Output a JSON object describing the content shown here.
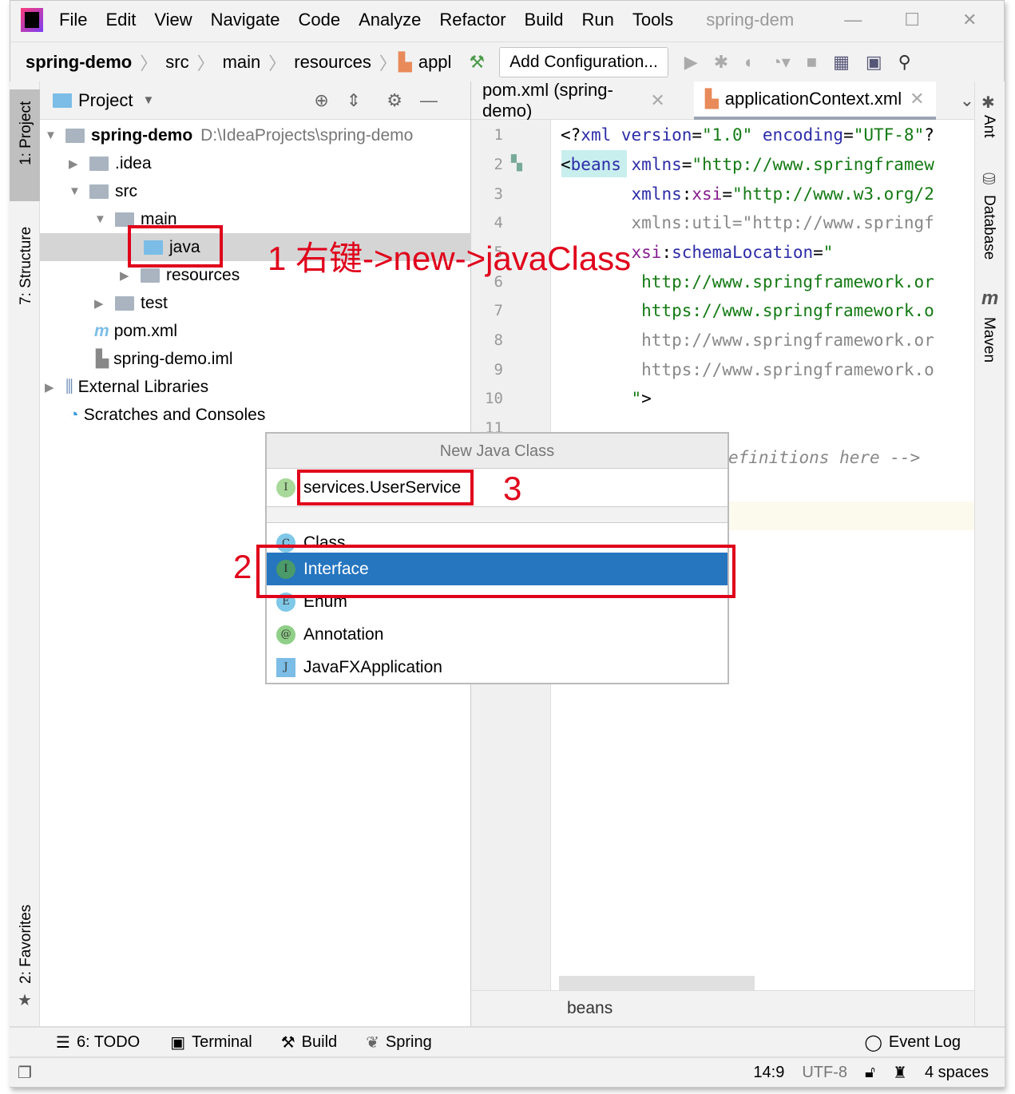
{
  "menu": {
    "items": [
      "File",
      "Edit",
      "View",
      "Navigate",
      "Code",
      "Analyze",
      "Refactor",
      "Build",
      "Run",
      "Tools"
    ],
    "window_title": "spring-dem"
  },
  "navbar": {
    "breadcrumbs": [
      "spring-demo",
      "src",
      "main",
      "resources",
      "appl"
    ],
    "add_config": "Add Configuration..."
  },
  "left_stripe": {
    "project": "1: Project",
    "structure": "7: Structure",
    "favorites": "2: Favorites"
  },
  "project_panel": {
    "title": "Project",
    "tree": [
      {
        "label": "spring-demo",
        "path": "D:\\IdeaProjects\\spring-demo"
      },
      {
        "label": ".idea"
      },
      {
        "label": "src"
      },
      {
        "label": "main"
      },
      {
        "label": "java"
      },
      {
        "label": "resources"
      },
      {
        "label": "test"
      },
      {
        "label": "pom.xml"
      },
      {
        "label": "spring-demo.iml"
      },
      {
        "label": "External Libraries"
      },
      {
        "label": "Scratches and Consoles"
      }
    ]
  },
  "editor": {
    "tabs": [
      {
        "label": "pom.xml (spring-demo)"
      },
      {
        "label": "applicationContext.xml",
        "active": true
      }
    ],
    "line_numbers": [
      "1",
      "2",
      "3",
      "4",
      "5",
      "6",
      "7",
      "8",
      "9",
      "10",
      "11"
    ],
    "comment_tail": "efinitions here -->",
    "breadcrumb": "beans"
  },
  "right_stripe": {
    "ant": "Ant",
    "database": "Database",
    "maven": "Maven"
  },
  "popup": {
    "title": "New Java Class",
    "input_value": "services.UserService",
    "items": [
      {
        "label": "Class",
        "icon": "C",
        "color": "#7fc8e8"
      },
      {
        "label": "Interface",
        "icon": "I",
        "color": "#4a9a6a",
        "selected": true
      },
      {
        "label": "Enum",
        "icon": "E",
        "color": "#7fc8e8"
      },
      {
        "label": "Annotation",
        "icon": "@",
        "color": "#8fcf88"
      },
      {
        "label": "JavaFXApplication",
        "icon": "J",
        "color": "#7bbde6"
      }
    ]
  },
  "annotations": {
    "step1": "1 右键->new->javaClass",
    "step2": "2",
    "step3": "3"
  },
  "bottom_tools": {
    "todo": "6: TODO",
    "terminal": "Terminal",
    "build": "Build",
    "spring": "Spring",
    "event_log": "Event Log"
  },
  "status": {
    "position": "14:9",
    "encoding": "UTF-8",
    "indent": "4 spaces"
  },
  "colors": {
    "selection": "#2675bf",
    "annotation_red": "#e0001a"
  }
}
